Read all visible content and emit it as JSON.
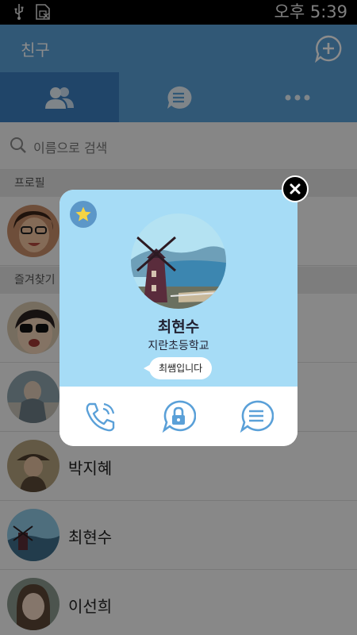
{
  "status_bar": {
    "time": "오후 5:39",
    "icons": [
      "usb-icon",
      "sim-error-icon"
    ]
  },
  "app_bar": {
    "title": "친구",
    "add_icon": "add-chat-icon"
  },
  "tabs": [
    {
      "icon": "friends-icon",
      "active": true
    },
    {
      "icon": "chats-icon",
      "active": false
    },
    {
      "icon": "more-icon",
      "active": false
    }
  ],
  "search": {
    "placeholder": "이름으로 검색"
  },
  "sections": {
    "profile": "프로필",
    "favorites": "즐겨찾기"
  },
  "friends": [
    {
      "name": "박지혜"
    },
    {
      "name": "최현수"
    },
    {
      "name": "이선희"
    }
  ],
  "popup": {
    "name": "최현수",
    "school": "지란초등학교",
    "status_message": "최쌤입니다",
    "favorite": true,
    "actions": [
      "phone-icon",
      "secret-chat-icon",
      "chat-icon"
    ],
    "colors": {
      "top": "#a6dcf6",
      "accent": "#5aa0d8"
    }
  }
}
